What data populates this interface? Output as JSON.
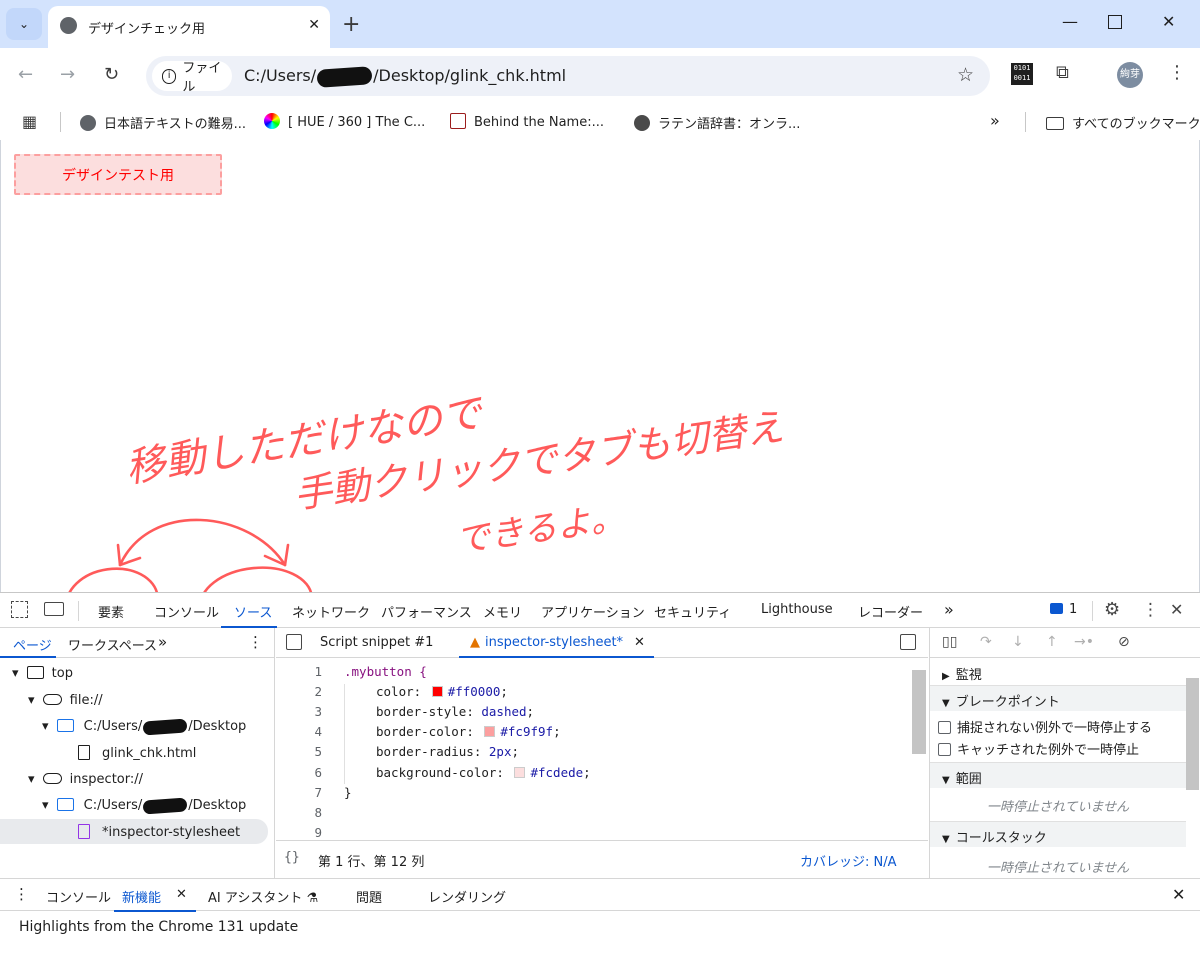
{
  "browser": {
    "tab_title": "デザインチェック用",
    "new_tab": "+",
    "address_chip": "ファイル",
    "url_prefix": "C:/Users/",
    "url_suffix": "/Desktop/glink_chk.html",
    "profile_label": "絢芽",
    "bookmarks": [
      {
        "label": "日本語テキストの難易...",
        "icon": "globe-icon"
      },
      {
        "label": "[ HUE / 360 ] The C...",
        "icon": "color-wheel-icon"
      },
      {
        "label": "Behind the Name:...",
        "icon": "behind-the-name-icon"
      },
      {
        "label": "ラテン語辞書：オンラ...",
        "icon": "avatar-icon"
      }
    ],
    "bookmarks_overflow": "»",
    "all_bookmarks": "すべてのブックマーク"
  },
  "page": {
    "button_text": "デザインテスト用"
  },
  "annotation": {
    "line1": "移動しただけなので",
    "line2": "手動クリックでタブも切替え",
    "line3": "できるよ。"
  },
  "devtools": {
    "tabs": [
      "要素",
      "コンソール",
      "ソース",
      "ネットワーク",
      "パフォーマンス",
      "メモリ",
      "アプリケーション",
      "セキュリティ",
      "Lighthouse",
      "レコーダー"
    ],
    "active_tab": "ソース",
    "overflow": "»",
    "issues_count": "1",
    "left_subtabs": [
      "ページ",
      "ワークスペース"
    ],
    "tree": {
      "top": "top",
      "file": "file://",
      "folder_prefix": "C:/Users/",
      "folder_suffix": "/Desktop",
      "file_name": "glink_chk.html",
      "inspector": "inspector://",
      "folder2_prefix": "C:/Users/",
      "folder2_suffix": "/Desktop",
      "stylesheet": "*inspector-stylesheet"
    },
    "editor_tabs": [
      "Script snippet #1",
      "inspector-stylesheet*"
    ],
    "code": {
      "line_numbers": [
        "1",
        "2",
        "3",
        "4",
        "5",
        "6",
        "7",
        "8",
        "9"
      ],
      "selector": ".mybutton {",
      "lines": [
        {
          "prop": "color",
          "value": "#ff0000",
          "swatch": "#ff0000"
        },
        {
          "prop": "border-style",
          "value": "dashed"
        },
        {
          "prop": "border-color",
          "value": "#fc9f9f",
          "swatch": "#fc9f9f"
        },
        {
          "prop": "border-radius",
          "value": "2px"
        },
        {
          "prop": "background-color",
          "value": "#fcdede",
          "swatch": "#fcdede"
        }
      ],
      "close": "}"
    },
    "status_position": "第 1 行、第 12 列",
    "coverage": "カバレッジ: N/A",
    "debugger": {
      "watch": "監視",
      "breakpoints": "ブレークポイント",
      "pause_uncaught": "捕捉されない例外で一時停止する",
      "pause_caught": "キャッチされた例外で一時停止",
      "scope": "範囲",
      "not_paused_1": "一時停止されていません",
      "call_stack": "コールスタック",
      "not_paused_2": "一時停止されていません"
    },
    "drawer": {
      "tabs": [
        "コンソール",
        "新機能",
        "AI アシスタント",
        "問題",
        "レンダリング"
      ],
      "active": "新機能",
      "message": "Highlights from the Chrome 131 update"
    }
  },
  "colors": {
    "accent": "#0b57d0",
    "annotation": "#ff5a5a",
    "tabstrip": "#d3e3fd"
  }
}
